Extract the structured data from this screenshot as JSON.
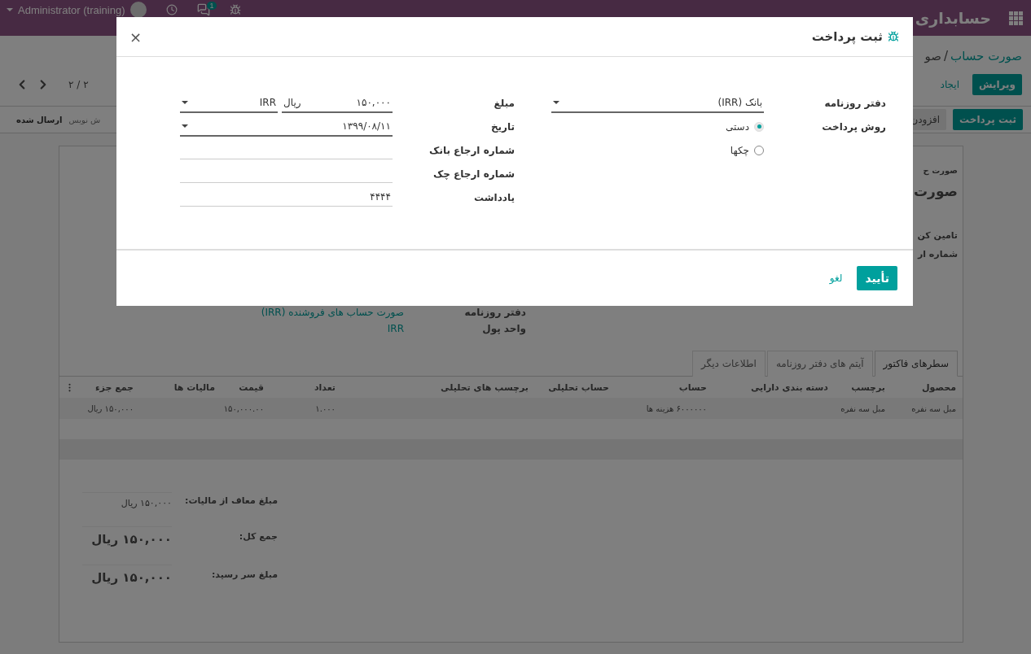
{
  "navbar": {
    "brand": "حسابداری",
    "user": "Administrator (training)",
    "message_count": "1"
  },
  "breadcrumb": {
    "items": [
      {
        "label": "صورت حساب",
        "kind": "link"
      },
      {
        "label": "صو",
        "kind": "current"
      }
    ],
    "separator": "/"
  },
  "actions": [
    {
      "label": "ویرایش",
      "kind": "primary"
    },
    {
      "label": "ایجاد",
      "kind": "link"
    }
  ],
  "pager": "۲ / ۲",
  "statusbar": {
    "buttons": [
      {
        "label": "ثبت پرداخت",
        "kind": "primary"
      },
      {
        "label": "افزودن",
        "kind": "secondary"
      }
    ],
    "stages": [
      {
        "label": "ش نویس",
        "selected": false
      },
      {
        "label": "ارسال شده",
        "selected": true
      }
    ]
  },
  "sheet": {
    "subtitle": "صورت ح",
    "title": "صورت",
    "fields": [
      "تامین کن",
      "شماره ار"
    ],
    "side_fields": [
      {
        "label": "دفتر روزنامه",
        "value": "صورت حساب های فروشنده (IRR)"
      },
      {
        "label": "واحد پول",
        "value": "IRR"
      }
    ]
  },
  "tabs": [
    {
      "label": "سطرهای فاکتور",
      "selected": true
    },
    {
      "label": "آیتم های دفتر روزنامه",
      "selected": false
    },
    {
      "label": "اطلاعات دیگر",
      "selected": false
    }
  ],
  "table": {
    "columns": [
      "محصول",
      "برچسب",
      "دسته بندی دارایی",
      "حساب",
      "حساب تحلیلی",
      "برچسب های تحلیلی",
      "تعداد",
      "قیمت",
      "مالیات ها",
      "جمع جزء"
    ],
    "rows": [
      {
        "cells": [
          "مبل سه نفره",
          "مبل سه نفره",
          null,
          "۶۰۰۰۰۰۰ هزینه ها",
          null,
          null,
          "۱.۰۰۰",
          "۱۵۰,۰۰۰.۰۰",
          null,
          "۱۵۰,۰۰۰ ریال"
        ]
      }
    ]
  },
  "totals": [
    {
      "label": "مبلغ معاف از مالیات:",
      "value": "۱۵۰,۰۰۰ ریال",
      "kind": "line"
    },
    {
      "label": "جمع کل:",
      "value": "۱۵۰,۰۰۰ ریال",
      "kind": "total"
    },
    {
      "label": "مبلغ سر رسید:",
      "value": "۱۵۰,۰۰۰ ریال",
      "kind": "total"
    }
  ],
  "modal": {
    "title": "ثبت پرداخت",
    "close": "×",
    "journal": {
      "label": "دفتر روزنامه",
      "value": "بانک (IRR)"
    },
    "payment_method": {
      "label": "روش پرداخت",
      "options": [
        {
          "label": "دستی",
          "selected": true
        },
        {
          "label": "چکها",
          "selected": false
        }
      ]
    },
    "amount": {
      "label": "مبلغ",
      "value": "۱۵۰,۰۰۰",
      "symbol": "ریال",
      "currency": "IRR"
    },
    "date": {
      "label": "تاریخ",
      "value": "۱۳۹۹/۰۸/۱۱"
    },
    "text_fields": [
      {
        "label": "شماره ارجاع بانک"
      },
      {
        "label": "شماره ارجاع چک"
      },
      {
        "label": "یادداشت",
        "value": "۴۴۴۴"
      }
    ],
    "buttons": [
      {
        "label": "تأیید",
        "kind": "primary"
      },
      {
        "label": "لغو",
        "kind": "link"
      }
    ]
  }
}
